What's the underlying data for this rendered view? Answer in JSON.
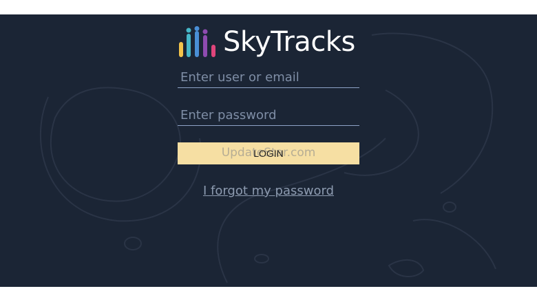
{
  "brand": {
    "name": "SkyTracks",
    "logo_icon": "bar-chart-people-logo",
    "bar_colors": [
      "#f3c44b",
      "#46b7c8",
      "#4a8fd6",
      "#8f4bb0",
      "#e0457b"
    ]
  },
  "login_form": {
    "user_placeholder": "Enter user or email",
    "password_placeholder": "Enter password",
    "login_label": "LOGIN",
    "forgot_link": "I forgot my password"
  },
  "watermark": {
    "text": "UpdateStar.com"
  },
  "colors": {
    "panel_background": "#1b2535",
    "button_background": "#f6dfa3",
    "input_underline": "#8fa3c8"
  }
}
